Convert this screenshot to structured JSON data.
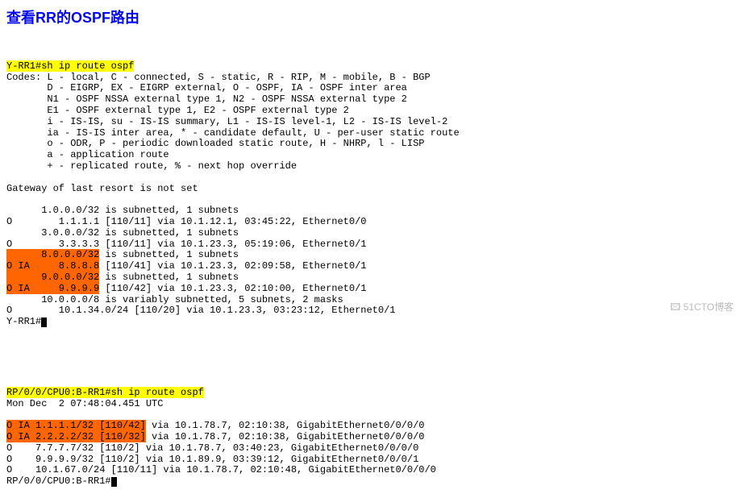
{
  "title": "查看RR的OSPF路由",
  "watermark": "🖾 51CTO博客",
  "block1": {
    "prompt_prefix": "Y-RR1#",
    "cmd": "sh ip route ospf",
    "codes": [
      "Codes: L - local, C - connected, S - static, R - RIP, M - mobile, B - BGP",
      "       D - EIGRP, EX - EIGRP external, O - OSPF, IA - OSPF inter area ",
      "       N1 - OSPF NSSA external type 1, N2 - OSPF NSSA external type 2",
      "       E1 - OSPF external type 1, E2 - OSPF external type 2",
      "       i - IS-IS, su - IS-IS summary, L1 - IS-IS level-1, L2 - IS-IS level-2",
      "       ia - IS-IS inter area, * - candidate default, U - per-user static route",
      "       o - ODR, P - periodic downloaded static route, H - NHRP, l - LISP",
      "       a - application route",
      "       + - replicated route, % - next hop override"
    ],
    "gateway": "Gateway of last resort is not set",
    "r1a": "      1.0.0.0/32 is subnetted, 1 subnets",
    "r1b": "O        1.1.1.1 [110/11] via 10.1.12.1, 03:45:22, Ethernet0/0",
    "r2a": "      3.0.0.0/32 is subnetted, 1 subnets",
    "r2b": "O        3.3.3.3 [110/11] via 10.1.23.3, 05:19:06, Ethernet0/1",
    "r3a_hl": "      8.0.0.0/32",
    "r3a_tail": " is subnetted, 1 subnets",
    "r3b_hl": "O IA     8.8.8.8",
    "r3b_tail": " [110/41] via 10.1.23.3, 02:09:58, Ethernet0/1",
    "r4a_hl": "      9.0.0.0/32",
    "r4a_tail": " is subnetted, 1 subnets",
    "r4b_hl": "O IA     9.9.9.9",
    "r4b_tail": " [110/42] via 10.1.23.3, 02:10:00, Ethernet0/1",
    "r5a": "      10.0.0.0/8 is variably subnetted, 5 subnets, 2 masks",
    "r5b": "O        10.1.34.0/24 [110/20] via 10.1.23.3, 03:23:12, Ethernet0/1",
    "end_prompt": "Y-RR1#"
  },
  "block2": {
    "prompt_prefix": "RP/0/0/CPU0:B-RR1#",
    "cmd": "sh ip route ospf",
    "ts": "Mon Dec  2 07:48:04.451 UTC",
    "l1_hl": "O IA 1.1.1.1/32 [110/42]",
    "l1_tail": " via 10.1.78.7, 02:10:38, GigabitEthernet0/0/0/0",
    "l2_hl": "O IA 2.2.2.2/32 [110/32]",
    "l2_tail": " via 10.1.78.7, 02:10:38, GigabitEthernet0/0/0/0",
    "l3": "O    7.7.7.7/32 [110/2] via 10.1.78.7, 03:40:23, GigabitEthernet0/0/0/0",
    "l4": "O    9.9.9.9/32 [110/2] via 10.1.89.9, 03:39:12, GigabitEthernet0/0/0/1",
    "l5": "O    10.1.67.0/24 [110/11] via 10.1.78.7, 02:10:48, GigabitEthernet0/0/0/0",
    "end_prompt": "RP/0/0/CPU0:B-RR1#"
  }
}
